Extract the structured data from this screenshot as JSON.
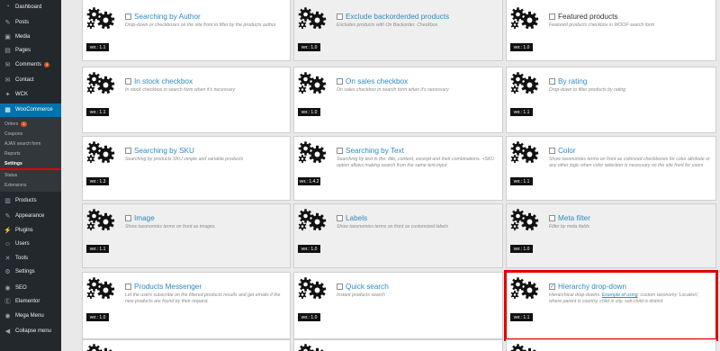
{
  "sidebar": {
    "items_top": [
      {
        "label": "Dashboard",
        "icon": "dashboard-icon",
        "glyph": "◔"
      },
      {
        "label": "Posts",
        "icon": "pin-icon",
        "glyph": "✎"
      },
      {
        "label": "Media",
        "icon": "media-icon",
        "glyph": "▣"
      },
      {
        "label": "Pages",
        "icon": "page-icon",
        "glyph": "▤"
      },
      {
        "label": "Comments",
        "icon": "comment-icon",
        "glyph": "✉",
        "badge": "4"
      },
      {
        "label": "Contact",
        "icon": "mail-icon",
        "glyph": "✉"
      },
      {
        "label": "WCK",
        "icon": "wrench-icon",
        "glyph": "✦"
      }
    ],
    "woocommerce": {
      "label": "WooCommerce",
      "icon": "woocommerce-icon",
      "glyph": "▦"
    },
    "submenu": [
      {
        "label": "Orders",
        "badge": "3"
      },
      {
        "label": "Coupons"
      },
      {
        "label": "AJAX search form"
      },
      {
        "label": "Reports"
      },
      {
        "label": "Settings",
        "current": true
      },
      {
        "label": "Status"
      },
      {
        "label": "Extensions"
      }
    ],
    "items_bottom": [
      {
        "label": "Products",
        "icon": "products-icon",
        "glyph": "▥"
      },
      {
        "label": "Appearance",
        "icon": "brush-icon",
        "glyph": "✎"
      },
      {
        "label": "Plugins",
        "icon": "plugin-icon",
        "glyph": "⚡"
      },
      {
        "label": "Users",
        "icon": "users-icon",
        "glyph": "☺"
      },
      {
        "label": "Tools",
        "icon": "tools-icon",
        "glyph": "✕"
      },
      {
        "label": "Settings",
        "icon": "settings-icon",
        "glyph": "⚙"
      },
      {
        "label": "SEO",
        "icon": "seo-icon",
        "glyph": "◉"
      },
      {
        "label": "Elementor",
        "icon": "elementor-icon",
        "glyph": "Ⓔ"
      },
      {
        "label": "Mega Menu",
        "icon": "mega-menu-icon",
        "glyph": "◉"
      },
      {
        "label": "Collapse menu",
        "icon": "collapse-icon",
        "glyph": "◀"
      }
    ]
  },
  "extensions": [
    {
      "title": "Searching by Author",
      "version": "ver.: 1.1",
      "checked": false,
      "desc": "Drop-down or checkboxes on the site front to filter by the products author"
    },
    {
      "title": "Exclude backorderded products",
      "version": "ver.: 1.0",
      "checked": false,
      "desc": "Excludes products with On Backorder. Checkbox"
    },
    {
      "title": "Featured products",
      "version": "ver.: 1.0",
      "checked": false,
      "desc": "Featured products checkbox in WOOF search form"
    },
    {
      "title": "In stock checkbox",
      "version": "ver.: 1.1",
      "checked": false,
      "desc": "In stock checkbox in search form when it's necessary"
    },
    {
      "title": "On sales checkbox",
      "version": "ver.: 1.0",
      "checked": false,
      "desc": "On sales checkbox in search form when it's necessary"
    },
    {
      "title": "By rating",
      "version": "ver.: 1.1",
      "checked": false,
      "desc": "Drop-down to filter products by rating"
    },
    {
      "title": "Searching by SKU",
      "version": "ver.: 1.3",
      "checked": false,
      "desc": "Searching by products SKU simple and variable products"
    },
    {
      "title": "Searching by Text",
      "version": "ver.: 1.4.2",
      "checked": false,
      "desc": "Searching by text in the: title, content, excerpt and their combinations. +SKU option allows making search from the same text-input"
    },
    {
      "title": "Color",
      "version": "ver.: 1.1",
      "checked": false,
      "desc": "Show taxonomies terms on front as colorized checkboxes for color attribute or any other logic when color selection is necessary on the site front for users"
    },
    {
      "title": "Image",
      "version": "ver.: 1.1",
      "checked": false,
      "desc": "Show taxonomies terms on front as images."
    },
    {
      "title": "Labels",
      "version": "ver.: 1.0",
      "checked": false,
      "desc": "Show taxonomies terms on front as customized labels"
    },
    {
      "title": "Meta filter",
      "version": "ver.: 1.0",
      "checked": false,
      "desc": "Filter by meta fields"
    },
    {
      "title": "Products Messenger",
      "version": "ver.: 1.0",
      "checked": false,
      "desc": "Let the users subscribe on the filtered products results and get emails if the new products are found by their request."
    },
    {
      "title": "Quick search",
      "version": "ver.: 1.0",
      "checked": false,
      "desc": "Instant products search"
    },
    {
      "title": "Hierarchy drop-down",
      "version": "ver.: 1.1",
      "checked": true,
      "desc_pre": "Hierarchical drop-downs. ",
      "desc_link": "Example of using",
      "desc_post": ": custom taxonomy 'Location', where parent is country, child is city, sub-child is district"
    }
  ]
}
